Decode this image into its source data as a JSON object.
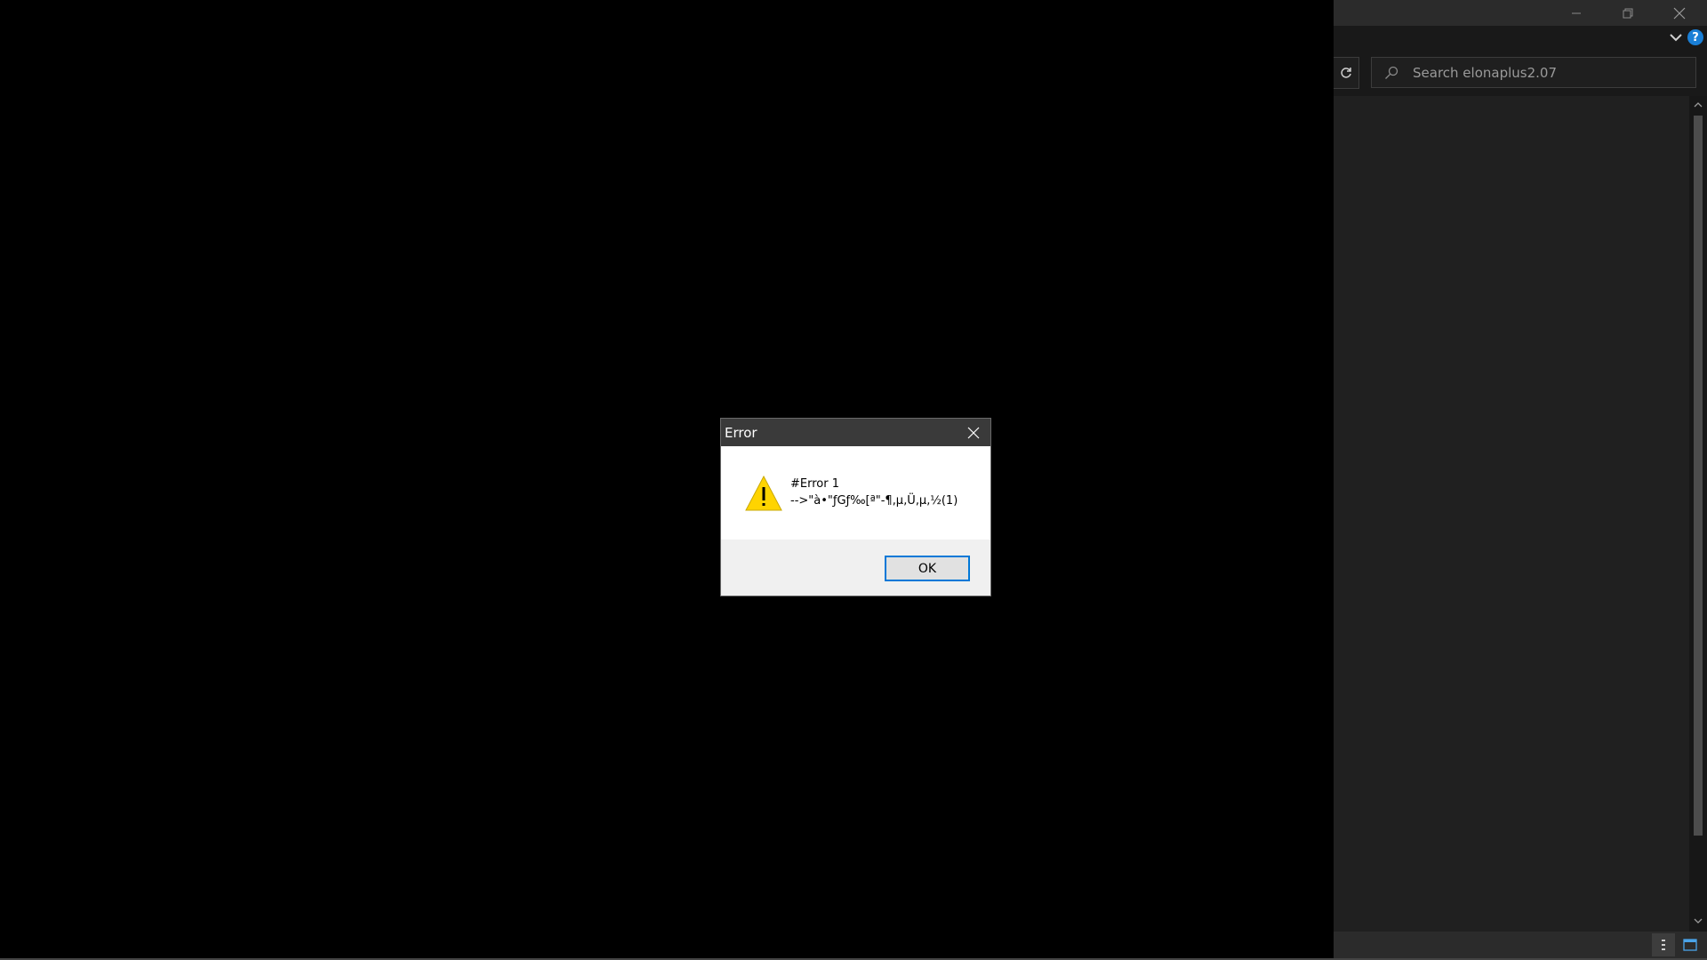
{
  "explorer": {
    "search_placeholder": "Search elonaplus2.07",
    "help_label": "?"
  },
  "dialog": {
    "title": "Error",
    "message_line1": "#Error 1",
    "message_line2": "-->\"à•\"ƒGƒ‰[ª\"-¶‚µ‚Ü‚µ‚½(1)",
    "ok_label": "OK"
  }
}
